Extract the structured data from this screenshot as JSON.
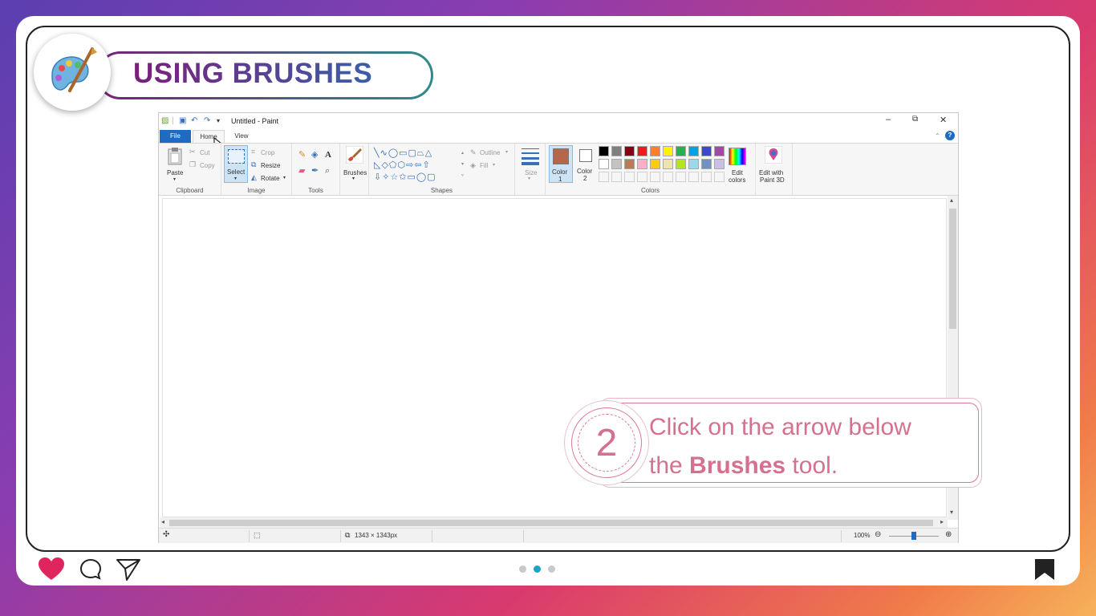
{
  "header": {
    "title": "USING BRUSHES",
    "logo_icon": "palette-icon"
  },
  "window": {
    "title": "Untitled - Paint",
    "tabs": [
      "File",
      "Home",
      "View"
    ],
    "clipboard": {
      "paste": "Paste",
      "cut": "Cut",
      "copy": "Copy",
      "label": "Clipboard"
    },
    "image": {
      "select": "Select",
      "crop": "Crop",
      "resize": "Resize",
      "rotate": "Rotate",
      "label": "Image"
    },
    "tools": {
      "label": "Tools"
    },
    "brushes": {
      "label": "Brushes"
    },
    "shapes": {
      "outline": "Outline",
      "fill": "Fill",
      "label": "Shapes"
    },
    "size": {
      "label": "Size"
    },
    "colors": {
      "color1_line1": "Color",
      "color1_line2": "1",
      "color2_line1": "Color",
      "color2_line2": "2",
      "edit_line1": "Edit",
      "edit_line2": "colors",
      "label": "Colors",
      "color1_value": "#b8664a",
      "palette_row1": [
        "#000000",
        "#7f7f7f",
        "#880015",
        "#ed1c24",
        "#ff7f27",
        "#fff200",
        "#22b14c",
        "#00a2e8",
        "#3f48cc",
        "#a349a4"
      ],
      "palette_row2": [
        "#ffffff",
        "#c3c3c3",
        "#b97a57",
        "#ffaec9",
        "#ffc90e",
        "#efe4b0",
        "#b5e61d",
        "#99d9ea",
        "#7092be",
        "#c8bfe7"
      ]
    },
    "paint3d": {
      "line1": "Edit with",
      "line2": "Paint 3D"
    },
    "status": {
      "dimensions": "1343 × 1343px",
      "zoom": "100%",
      "zoom_fraction": 0.5
    }
  },
  "step": {
    "number": "2",
    "text_before": "Click on the arrow below",
    "text_mid_pre": "the ",
    "text_bold": "Brushes",
    "text_after": " tool."
  },
  "footer": {
    "like_icon": "heart-icon",
    "comment_icon": "comment-icon",
    "share_icon": "send-icon",
    "save_icon": "bookmark-icon",
    "active_page": 2
  }
}
